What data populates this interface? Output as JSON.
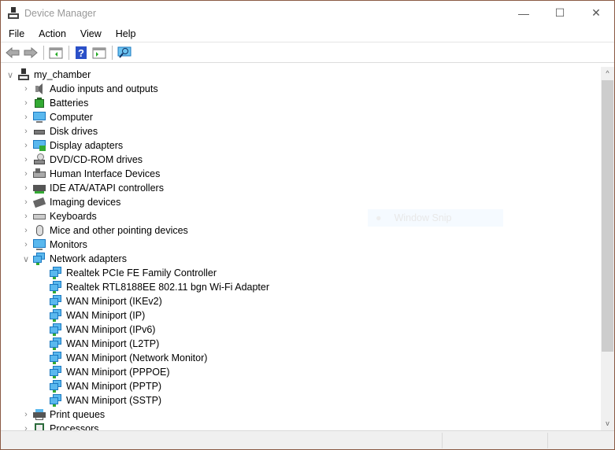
{
  "window": {
    "title": "Device Manager",
    "minimize": "—",
    "maximize": "☐",
    "close": "✕"
  },
  "menu": [
    "File",
    "Action",
    "View",
    "Help"
  ],
  "toolbar": {
    "icons": [
      "back-icon",
      "forward-icon",
      "show-hide-console-tree-icon",
      "help-icon",
      "action-pane-icon",
      "scan-hardware-icon"
    ]
  },
  "tree": {
    "root": "my_chamber",
    "categories": [
      {
        "label": "Audio inputs and outputs",
        "icon": "speaker-icon"
      },
      {
        "label": "Batteries",
        "icon": "battery-icon"
      },
      {
        "label": "Computer",
        "icon": "computer-icon"
      },
      {
        "label": "Disk drives",
        "icon": "disk-drive-icon"
      },
      {
        "label": "Display adapters",
        "icon": "display-adapter-icon"
      },
      {
        "label": "DVD/CD-ROM drives",
        "icon": "dvd-icon"
      },
      {
        "label": "Human Interface Devices",
        "icon": "hid-icon"
      },
      {
        "label": "IDE ATA/ATAPI controllers",
        "icon": "ide-icon"
      },
      {
        "label": "Imaging devices",
        "icon": "camera-icon"
      },
      {
        "label": "Keyboards",
        "icon": "keyboard-icon"
      },
      {
        "label": "Mice and other pointing devices",
        "icon": "mouse-icon"
      },
      {
        "label": "Monitors",
        "icon": "monitor-icon"
      },
      {
        "label": "Network adapters",
        "icon": "network-icon",
        "expanded": true
      }
    ],
    "network_children": [
      "Realtek PCIe FE Family Controller",
      "Realtek RTL8188EE 802.11 bgn Wi-Fi Adapter",
      "WAN Miniport (IKEv2)",
      "WAN Miniport (IP)",
      "WAN Miniport (IPv6)",
      "WAN Miniport (L2TP)",
      "WAN Miniport (Network Monitor)",
      "WAN Miniport (PPPOE)",
      "WAN Miniport (PPTP)",
      "WAN Miniport (SSTP)"
    ],
    "after": [
      {
        "label": "Print queues",
        "icon": "printer-icon"
      },
      {
        "label": "Processors",
        "icon": "processor-icon"
      }
    ]
  },
  "overlay": {
    "snip": "Window Snip"
  },
  "colors": {
    "border": "#8a5a44",
    "accent": "#1e7fd8"
  }
}
